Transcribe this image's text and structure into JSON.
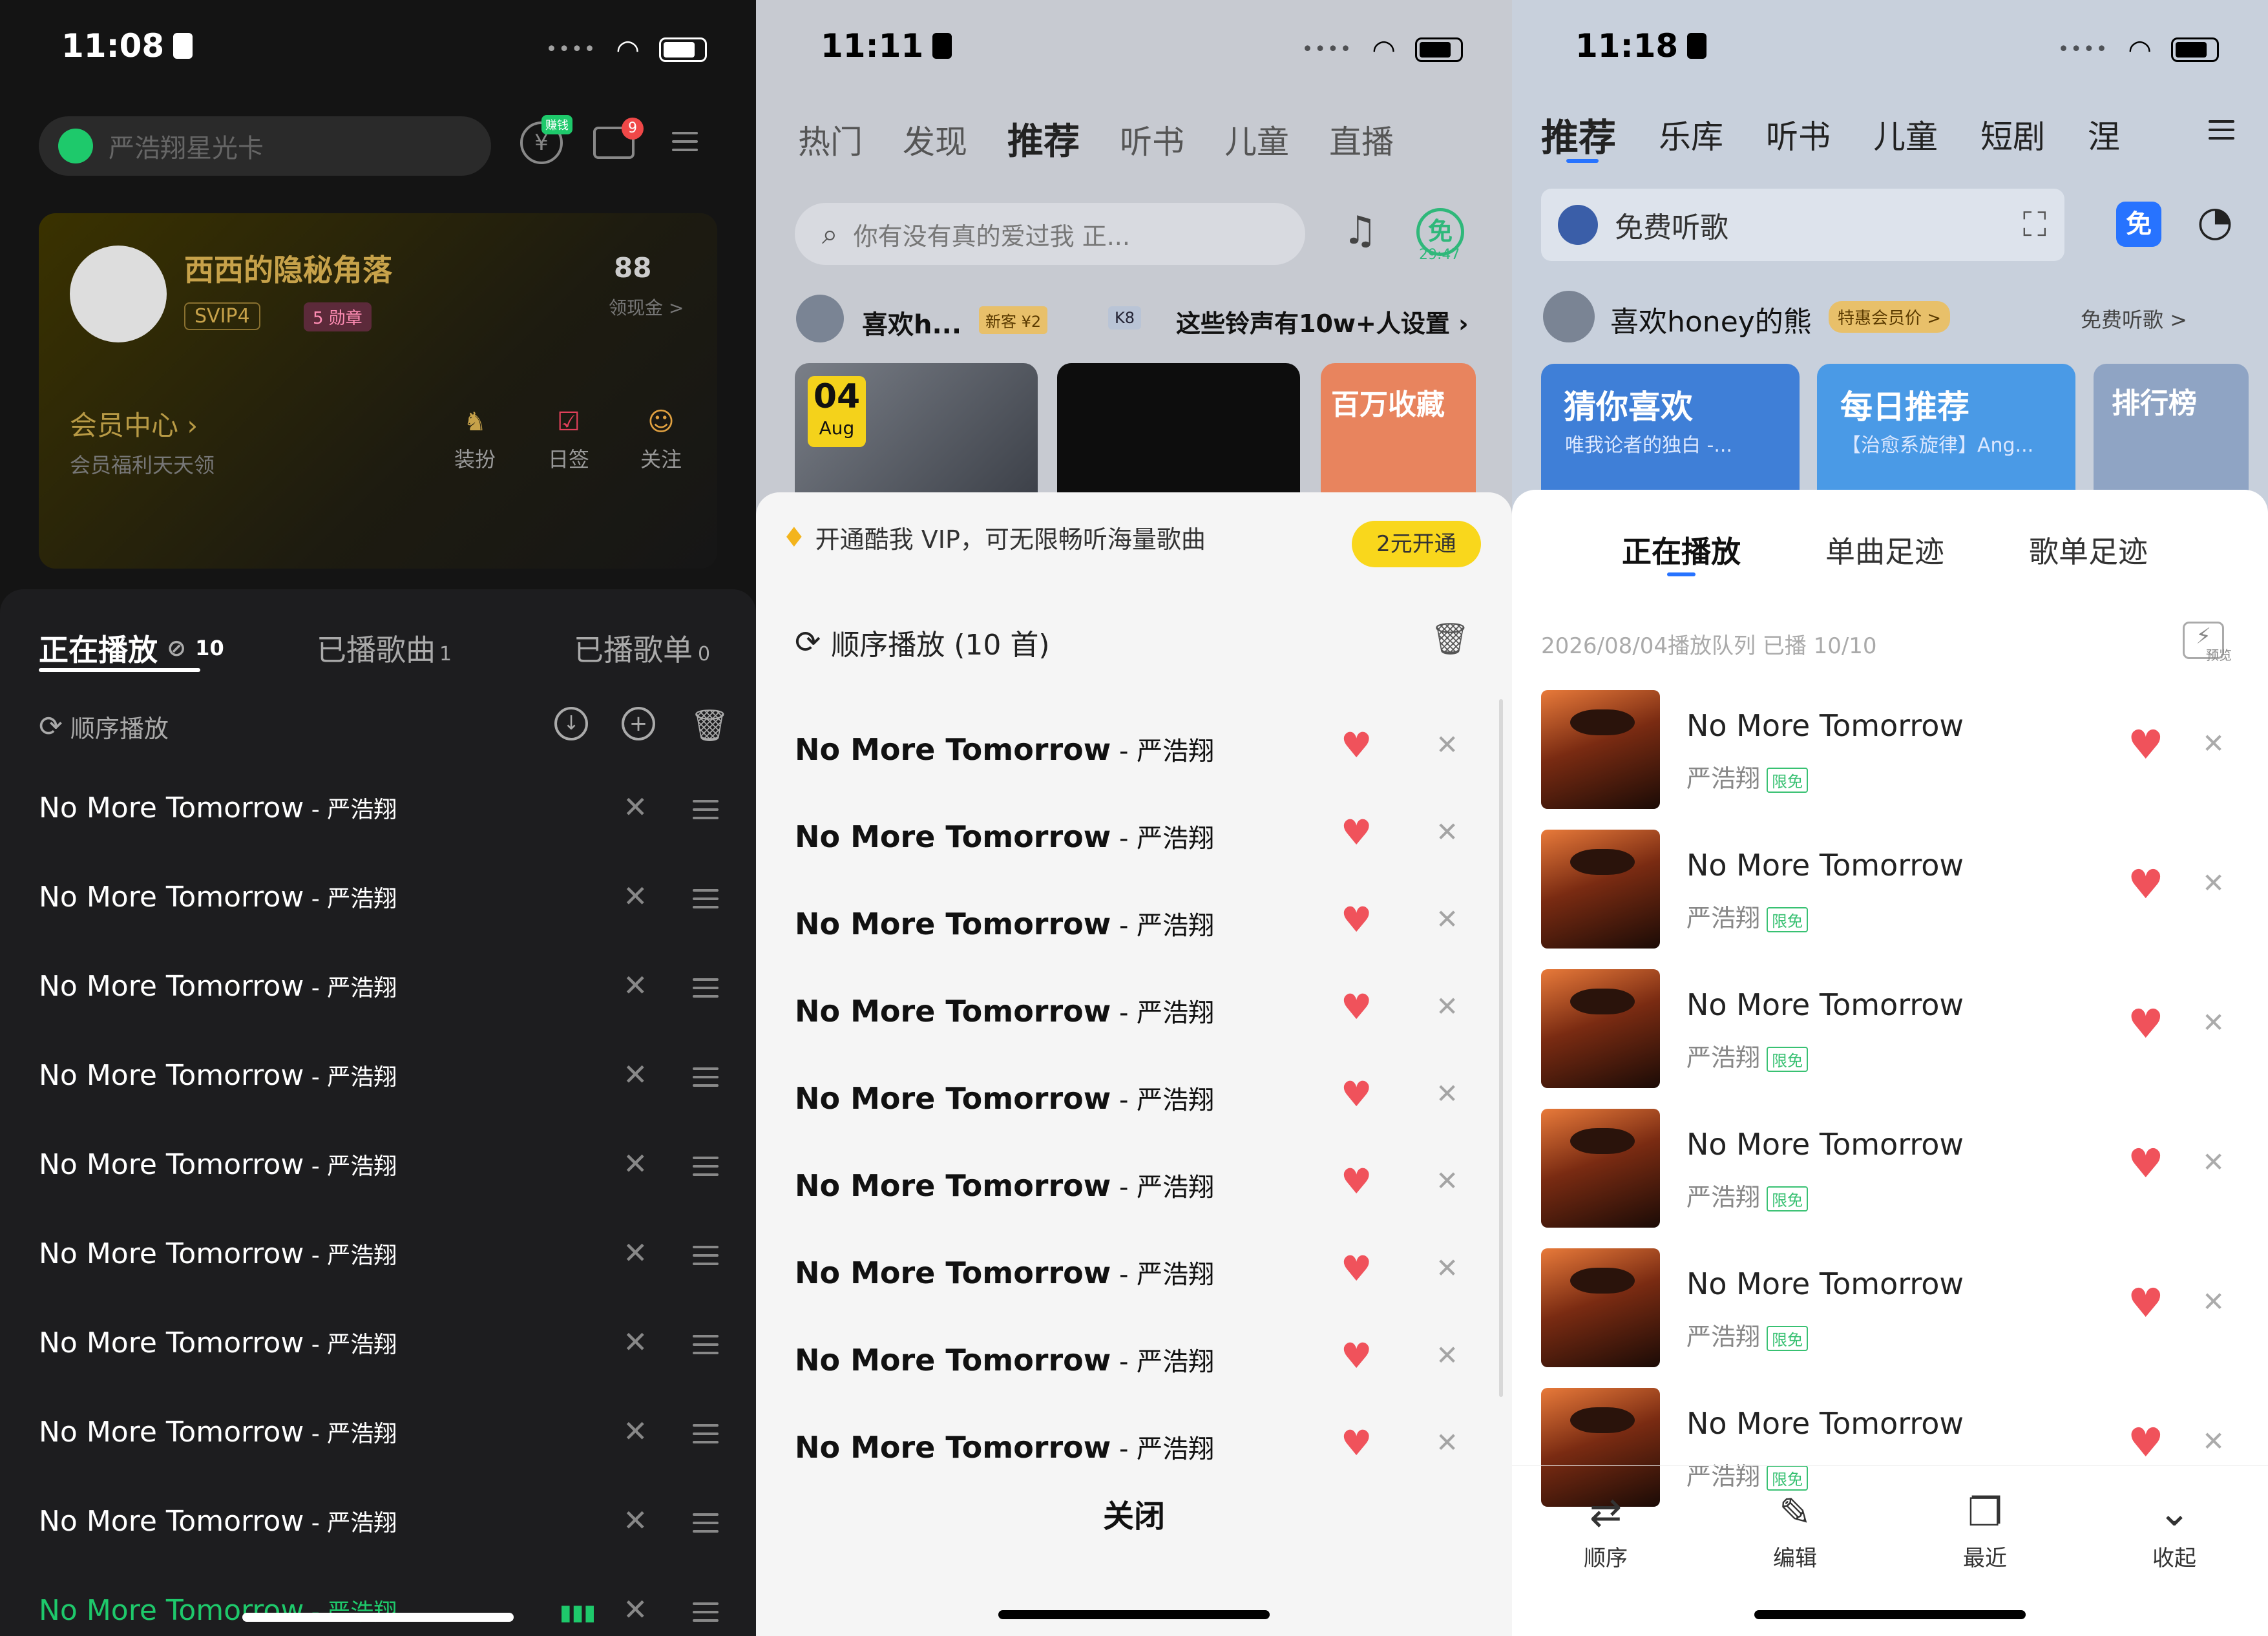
{
  "s1": {
    "time": "11:08",
    "search_placeholder": "严浩翔星光卡",
    "badge_mail": "9",
    "badge_coin": "赚钱",
    "user_name": "西西的隐秘角落",
    "vip": "SVIP4",
    "medal": "5 勋章",
    "gold": "88",
    "gold_label": "领现金 >",
    "member_center": "会员中心",
    "member_sub": "会员福利天天领",
    "shortcuts": [
      "装扮",
      "日签",
      "关注"
    ],
    "tabs": {
      "playing": "正在播放",
      "playing_count": "10",
      "played_songs": "已播歌曲",
      "played_songs_count": "1",
      "played_lists": "已播歌单",
      "played_lists_count": "0"
    },
    "mode": "顺序播放",
    "songs": [
      "No More Tomorrow",
      "No More Tomorrow",
      "No More Tomorrow",
      "No More Tomorrow",
      "No More Tomorrow",
      "No More Tomorrow",
      "No More Tomorrow",
      "No More Tomorrow",
      "No More Tomorrow",
      "No More Tomorrow"
    ],
    "artist": "严浩翔",
    "sep": " - ",
    "accent": "#1ec96b"
  },
  "s2": {
    "time": "11:11",
    "nav": [
      "热门",
      "发现",
      "推荐",
      "听书",
      "儿童",
      "直播"
    ],
    "search_placeholder": "你有没有真的爱过我  正...",
    "free_timer": "29:47",
    "free_label": "免",
    "user": "喜欢h...",
    "user_badges": [
      "新客 ¥2",
      "K8"
    ],
    "promo": "这些铃声有10w+人设置",
    "card_date": "04",
    "card_month": "Aug",
    "card3": "百万收藏",
    "vip_banner": "开通酷我 VIP，可无限畅听海量歌曲",
    "vip_btn": "2元开通",
    "mode": "顺序播放 (10 首)",
    "songs": [
      "No More Tomorrow",
      "No More Tomorrow",
      "No More Tomorrow",
      "No More Tomorrow",
      "No More Tomorrow",
      "No More Tomorrow",
      "No More Tomorrow",
      "No More Tomorrow",
      "No More Tomorrow"
    ],
    "artist": "严浩翔",
    "sep": " - ",
    "close": "关闭"
  },
  "s3": {
    "time": "11:18",
    "nav": [
      "推荐",
      "乐库",
      "听书",
      "儿童",
      "短剧",
      "涅"
    ],
    "search_text": "免费听歌",
    "user": "喜欢honey的熊",
    "vip_badge": "特惠会员价 >",
    "free_listen": "免费听歌 >",
    "cards": [
      {
        "title": "猜你喜欢",
        "sub": "唯我论者的独白 -..."
      },
      {
        "title": "每日推荐",
        "sub": "【治愈系旋律】Ang..."
      },
      {
        "title": "排行榜",
        "sub": ""
      }
    ],
    "tabs": [
      "正在播放",
      "单曲足迹",
      "歌单足迹"
    ],
    "queue_info": "2026/08/04播放队列  已播 10/10",
    "preview": "预览",
    "songs": [
      "No More Tomorrow",
      "No More Tomorrow",
      "No More Tomorrow",
      "No More Tomorrow",
      "No More Tomorrow",
      "No More Tomorrow"
    ],
    "artist": "严浩翔",
    "free_tag": "限免",
    "toolbar": [
      "顺序",
      "编辑",
      "最近",
      "收起"
    ]
  }
}
